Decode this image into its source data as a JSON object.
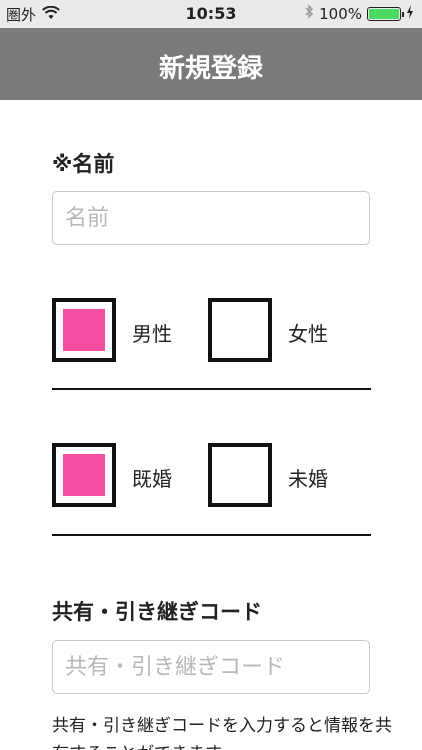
{
  "status": {
    "carrier": "圏外",
    "time": "10:53",
    "battery": "100%",
    "icons": [
      "wifi-icon",
      "bluetooth-icon",
      "battery-icon",
      "charging-icon"
    ]
  },
  "nav": {
    "title": "新規登録"
  },
  "name_section": {
    "label": "※名前",
    "placeholder": "名前"
  },
  "gender": {
    "options": [
      {
        "label": "男性",
        "checked": true
      },
      {
        "label": "女性",
        "checked": false
      }
    ]
  },
  "marital": {
    "options": [
      {
        "label": "既婚",
        "checked": true
      },
      {
        "label": "未婚",
        "checked": false
      }
    ]
  },
  "code_section": {
    "label": "共有・引き継ぎコード",
    "placeholder": "共有・引き継ぎコード",
    "help": "共有・引き継ぎコードを入力すると情報を共有することができます。"
  },
  "colors": {
    "accent": "#f54ea0",
    "navbar": "#7a7a7a"
  }
}
